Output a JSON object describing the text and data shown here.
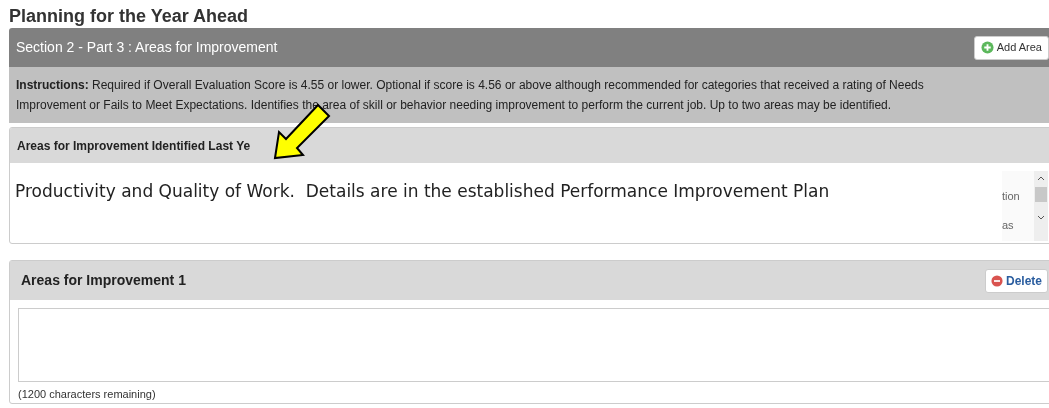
{
  "page_title": "Planning for the Year Ahead",
  "section": {
    "title": "Section 2 - Part 3 : Areas for Improvement",
    "add_button": "Add Area",
    "instructions": "**Instructions:** Required if Overall Evaluation Score is 4.55 or lower. Optional if score is 4.56 or above although recommended for categories that received a rating of Needs Improvement or Fails to Meet Expectations. Identifies the area of skill or behavior needing improvement to perform the current job. Up to two areas may be identified."
  },
  "last_year": {
    "title": "Areas for Improvement Identified Last Ye",
    "pasted_text": "Productivity and Quality of Work.  Details are in the established Performance Improvement Plan",
    "hidden_fragments": [
      "tion",
      "as"
    ]
  },
  "areas": [
    {
      "title": "Areas for Improvement 1",
      "delete_button": "Delete",
      "remaining": "(1200 characters remaining)"
    }
  ]
}
